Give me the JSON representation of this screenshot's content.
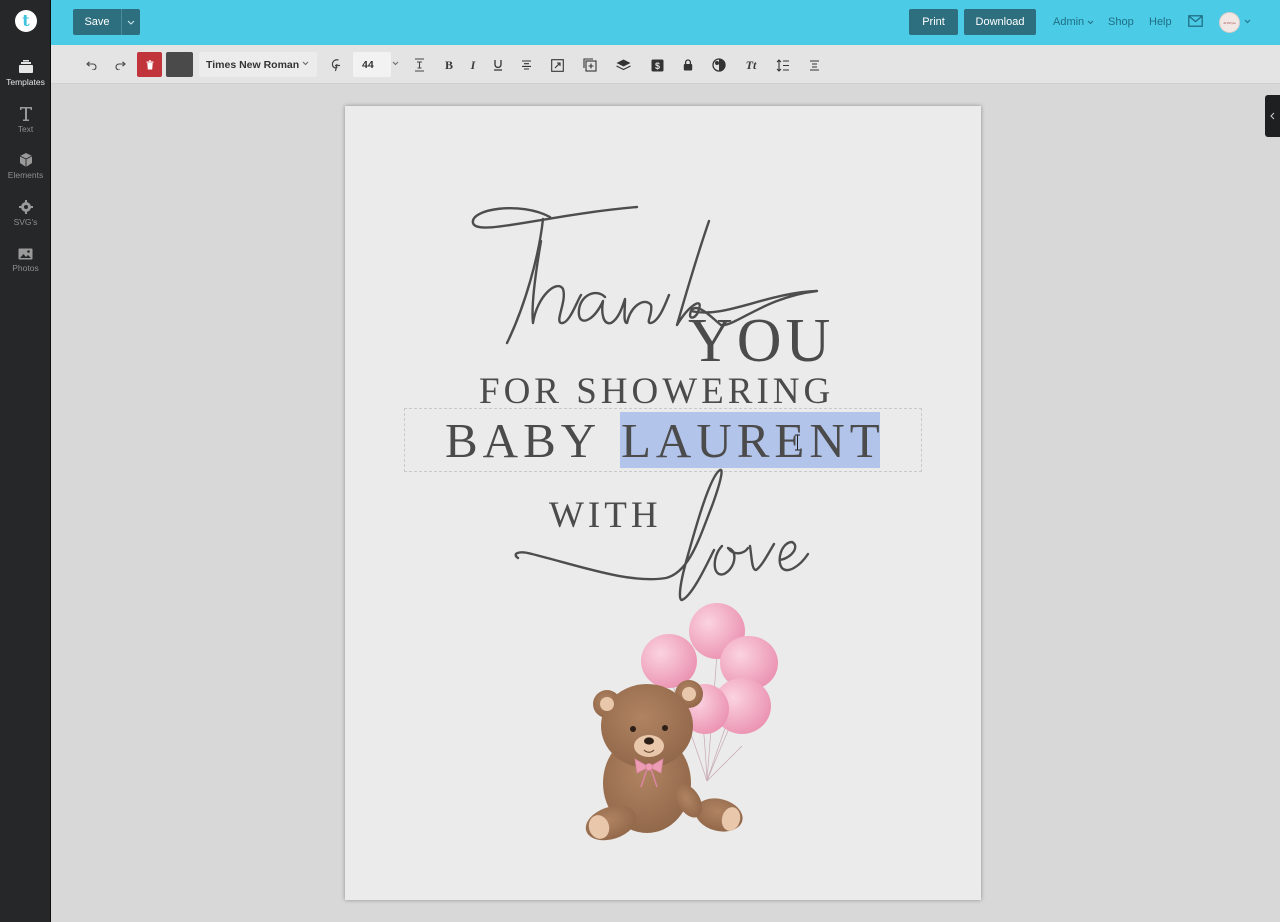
{
  "app": {
    "logo_letter": "t"
  },
  "sidebar": {
    "items": [
      {
        "label": "Templates",
        "icon": "templates-icon",
        "active": true
      },
      {
        "label": "Text",
        "icon": "text-icon"
      },
      {
        "label": "Elements",
        "icon": "cube-icon"
      },
      {
        "label": "SVG's",
        "icon": "gear-icon"
      },
      {
        "label": "Photos",
        "icon": "image-icon"
      }
    ]
  },
  "topbar": {
    "save_label": "Save",
    "print_label": "Print",
    "download_label": "Download",
    "admin_label": "Admin",
    "shop_label": "Shop",
    "help_label": "Help",
    "avatar_text": "ArtStyle",
    "accent_color": "#4ccbe6",
    "button_color": "#2d6f7e"
  },
  "toolbar": {
    "font_family": "Times New Roman",
    "font_size": "44",
    "text_color": "#4a4a4a",
    "tools": [
      "undo-icon",
      "redo-icon",
      "trash-icon",
      "color-swatch",
      "font-style-icon",
      "line-height-icon",
      "bold-icon",
      "italic-icon",
      "underline-icon",
      "align-center-icon",
      "resize-icon",
      "duplicate-icon",
      "layers-icon",
      "dollar-icon",
      "lock-icon",
      "opacity-icon",
      "text-case-icon",
      "line-spacing-icon",
      "vertical-align-icon"
    ]
  },
  "card": {
    "script_thank": "Thank",
    "you": "YOU",
    "for_showering": "FOR SHOWERING",
    "baby": "BABY",
    "name": "LAURENT",
    "with": "WITH",
    "script_love": "love",
    "illustration": "teddy bear with pink balloons",
    "selection_color": "#b3c4ea"
  }
}
